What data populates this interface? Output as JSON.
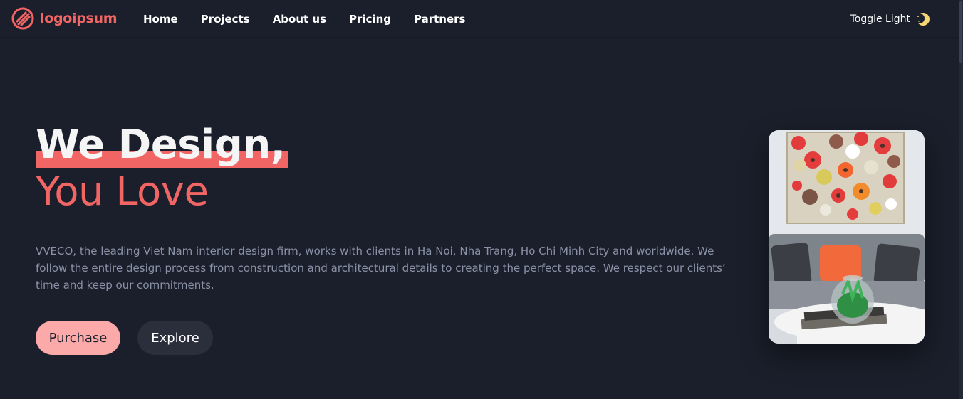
{
  "logo": {
    "text": "logoipsum",
    "color": "#f26565"
  },
  "nav": {
    "links": [
      "Home",
      "Projects",
      "About us",
      "Pricing",
      "Partners"
    ]
  },
  "toggle": {
    "label": "Toggle Light",
    "icon": "moon-icon"
  },
  "hero": {
    "headline_line1": "We Design,",
    "headline_line2": "You Love",
    "description": "VVECO, the leading Viet Nam interior design firm, works with clients in Ha Noi, Nha Trang, Ho Chi Minh City and worldwide. We follow the entire design process from construction and architectural details to creating the perfect space. We respect our clients’ time and keep our commitments.",
    "primary_button": "Purchase",
    "secondary_button": "Explore"
  },
  "colors": {
    "background": "#1b1f2b",
    "accent": "#f26565",
    "button_primary": "#fba9a9",
    "button_secondary": "#2b2f3c",
    "text_muted": "#8992a6"
  }
}
